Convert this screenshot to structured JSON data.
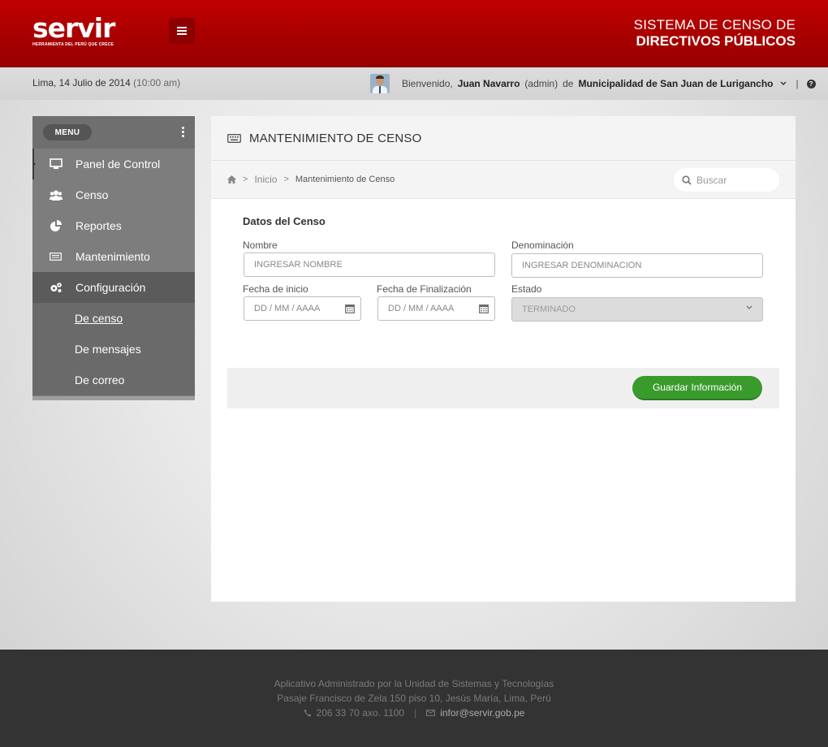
{
  "header": {
    "logo_text": "servir",
    "logo_tagline": "HERRAMIENTA DEL PERÚ QUE CRECE",
    "title_line1": "SISTEMA DE CENSO  DE",
    "title_line2": "DIRECTIVOS PÚBLICOS",
    "menu_icon": "hamburger-icon",
    "brand_color": "#b00000"
  },
  "infobar": {
    "date": "Lima, 14 Julio de 2014",
    "time": "(10:00 am)",
    "welcome": "Bienvenido,",
    "user_name": "Juan Navarro",
    "user_role": "(admin)",
    "of": "de",
    "organization": "Municipalidad de San Juan de Lurigancho",
    "help_icon": "question-icon"
  },
  "sidebar": {
    "menu_label": "MENU",
    "items": [
      {
        "label": "Panel de Control",
        "icon": "monitor-icon"
      },
      {
        "label": "Censo",
        "icon": "users-icon"
      },
      {
        "label": "Reportes",
        "icon": "pie-chart-icon"
      },
      {
        "label": "Mantenimiento",
        "icon": "keyboard-icon"
      },
      {
        "label": "Configuración",
        "icon": "gears-icon"
      }
    ],
    "subitems": [
      {
        "label": "De censo"
      },
      {
        "label": "De mensajes"
      },
      {
        "label": "De correo"
      }
    ]
  },
  "panel": {
    "title": "MANTENIMIENTO DE CENSO",
    "breadcrumb": [
      "Inicio",
      "Mantenimiento de Censo"
    ],
    "search_placeholder": "Buscar"
  },
  "form": {
    "section_title": "Datos del Censo",
    "nombre_label": "Nombre",
    "nombre_placeholder": "INGRESAR NOMBRE",
    "denominacion_label": "Denominación",
    "denominacion_placeholder": "INGRESAR DENOMINACIÓN",
    "fecha_inicio_label": "Fecha de inicio",
    "fecha_inicio_placeholder": "DD / MM / AAAA",
    "fecha_fin_label": "Fecha de Finalización",
    "fecha_fin_placeholder": "DD / MM / AAAA",
    "estado_label": "Estado",
    "estado_value": "TERMINADO",
    "save_button": "Guardar Información",
    "save_color": "#3a9b2d"
  },
  "footer": {
    "line1": "Aplicativo Administrado por la Unidad de Sistemas y Tecnologías",
    "line2": "Pasaje Francisco de Zela 150 piso 10, Jesús María, Lima, Perú",
    "phone": "206 33 70 axo. 1100",
    "email": "infor@servir.gob.pe"
  }
}
